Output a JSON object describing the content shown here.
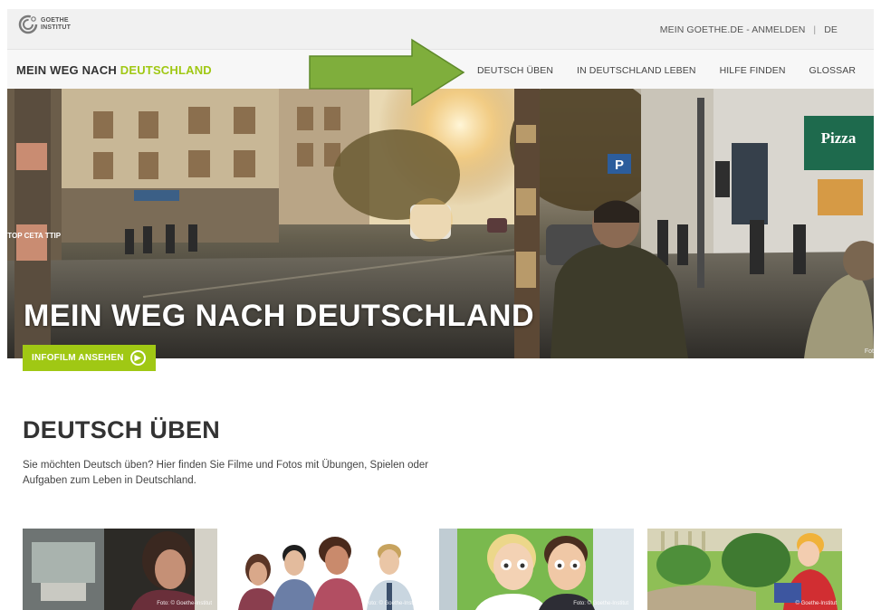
{
  "topbar": {
    "logo_line1": "GOETHE",
    "logo_line2": "INSTITUT",
    "login_link": "MEIN GOETHE.DE - ANMELDEN",
    "language": "DE"
  },
  "navbar": {
    "brand_part1": "MEIN WEG NACH ",
    "brand_part2": "DEUTSCHLAND",
    "items": [
      {
        "label": "DEUTSCH ÜBEN"
      },
      {
        "label": "IN DEUTSCHLAND LEBEN"
      },
      {
        "label": "HILFE FINDEN"
      },
      {
        "label": "GLOSSAR"
      }
    ]
  },
  "hero": {
    "title": "MEIN WEG NACH DEUTSCHLAND",
    "button_label": "INFOFILM ANSEHEN",
    "credit": "Fot",
    "shop_sign": "Pizza",
    "parking_sign": "P",
    "street_sign": "STOP CETA TTIP"
  },
  "main": {
    "title": "DEUTSCH ÜBEN",
    "intro": "Sie möchten Deutsch üben? Hier finden Sie Filme und Fotos mit Übungen, Spielen oder Aufgaben zum Leben in Deutschland.",
    "cards": [
      {
        "credit": "Foto: © Goethe-Institut"
      },
      {
        "credit": "Foto: © Goethe-Institut"
      },
      {
        "credit": "Foto: © Goethe-Institut"
      },
      {
        "credit": "© Goethe-Institut"
      }
    ]
  },
  "colors": {
    "accent_green": "#a0c814",
    "arrow_green": "#7fae3c",
    "text_dark": "#333333"
  }
}
